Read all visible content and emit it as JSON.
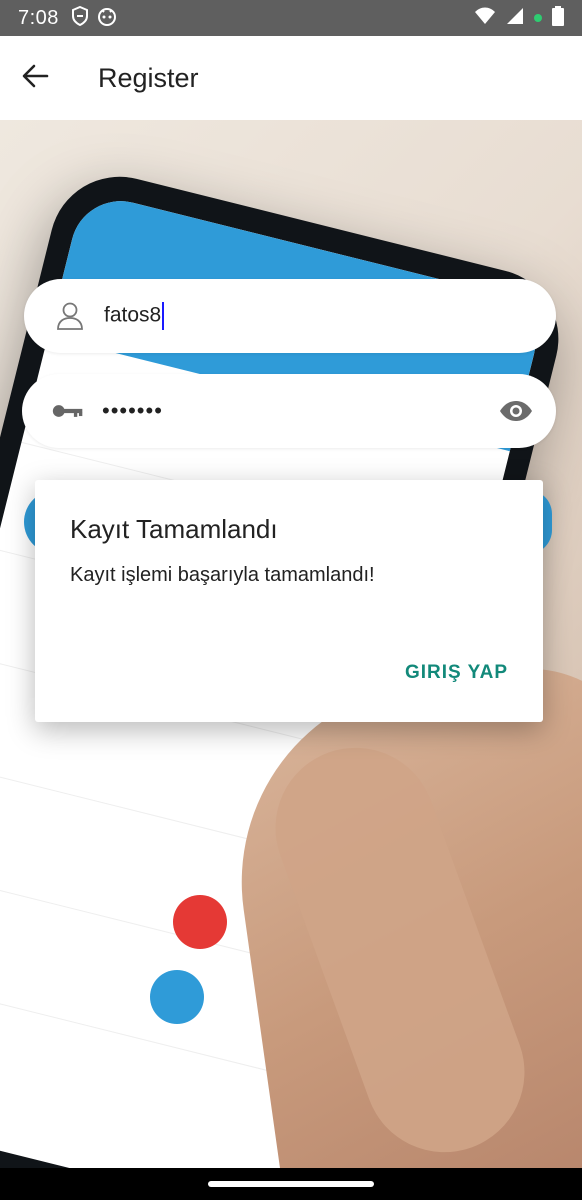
{
  "status_bar": {
    "time": "7:08",
    "icons": [
      "shield-icon",
      "robot-icon",
      "wifi-icon",
      "signal-icon",
      "battery-icon"
    ],
    "dot_color": "#2ecc71"
  },
  "app_bar": {
    "back_icon": "arrow-left-icon",
    "title": "Register"
  },
  "form": {
    "username": {
      "icon": "person-icon",
      "value": "fatos8"
    },
    "password": {
      "icon": "key-icon",
      "value": "•••••••",
      "toggle_icon": "eye-icon"
    }
  },
  "dialog": {
    "title": "Kayıt Tamamlandı",
    "message": "Kayıt işlemi başarıyla tamamlandı!",
    "action_label": "GIRIŞ YAP",
    "action_color": "#12897a"
  }
}
